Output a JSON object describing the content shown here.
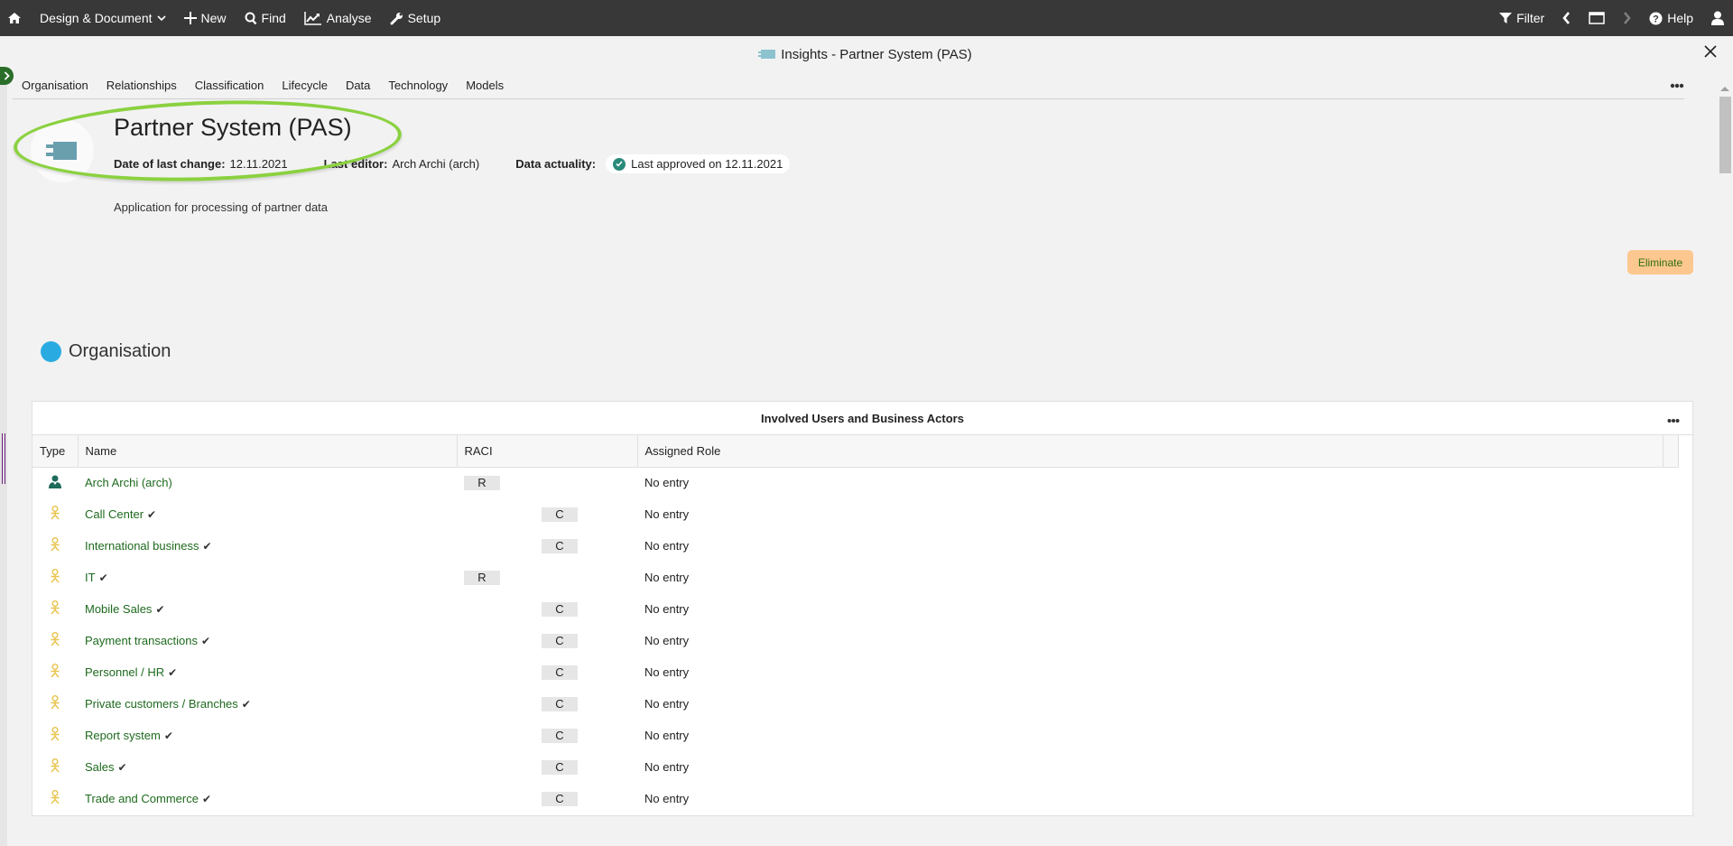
{
  "topnav": {
    "home": "home-icon",
    "design": "Design & Document",
    "new": "New",
    "find": "Find",
    "analyse": "Analyse",
    "setup": "Setup",
    "filter": "Filter",
    "help": "Help"
  },
  "window": {
    "title": "Insights - Partner System (PAS)"
  },
  "tabs": [
    "Organisation",
    "Relationships",
    "Classification",
    "Lifecycle",
    "Data",
    "Technology",
    "Models"
  ],
  "header": {
    "title": "Partner System (PAS)",
    "date_label": "Date of last change:",
    "date_value": "12.11.2021",
    "editor_label": "Last editor:",
    "editor_value": "Arch Archi (arch)",
    "actuality_label": "Data actuality:",
    "actuality_value": "Last approved on 12.11.2021",
    "description": "Application for processing of partner data",
    "status_badge": "Eliminate",
    "status_color": "#fcc88f"
  },
  "section": {
    "title": "Organisation",
    "color": "#29abe2"
  },
  "table": {
    "title": "Involved Users and Business Actors",
    "columns": [
      "Type",
      "Name",
      "RACI",
      "Assigned Role"
    ],
    "rows": [
      {
        "type": "user",
        "name": "Arch Archi (arch)",
        "checked": false,
        "raci": "R",
        "role": "No entry"
      },
      {
        "type": "actor",
        "name": "Call Center",
        "checked": true,
        "raci": "C",
        "role": "No entry"
      },
      {
        "type": "actor",
        "name": "International business",
        "checked": true,
        "raci": "C",
        "role": "No entry"
      },
      {
        "type": "actor",
        "name": "IT",
        "checked": true,
        "raci": "R",
        "role": "No entry"
      },
      {
        "type": "actor",
        "name": "Mobile Sales",
        "checked": true,
        "raci": "C",
        "role": "No entry"
      },
      {
        "type": "actor",
        "name": "Payment transactions",
        "checked": true,
        "raci": "C",
        "role": "No entry"
      },
      {
        "type": "actor",
        "name": "Personnel / HR",
        "checked": true,
        "raci": "C",
        "role": "No entry"
      },
      {
        "type": "actor",
        "name": "Private customers / Branches",
        "checked": true,
        "raci": "C",
        "role": "No entry"
      },
      {
        "type": "actor",
        "name": "Report system",
        "checked": true,
        "raci": "C",
        "role": "No entry"
      },
      {
        "type": "actor",
        "name": "Sales",
        "checked": true,
        "raci": "C",
        "role": "No entry"
      },
      {
        "type": "actor",
        "name": "Trade and Commerce",
        "checked": true,
        "raci": "C",
        "role": "No entry"
      }
    ]
  }
}
